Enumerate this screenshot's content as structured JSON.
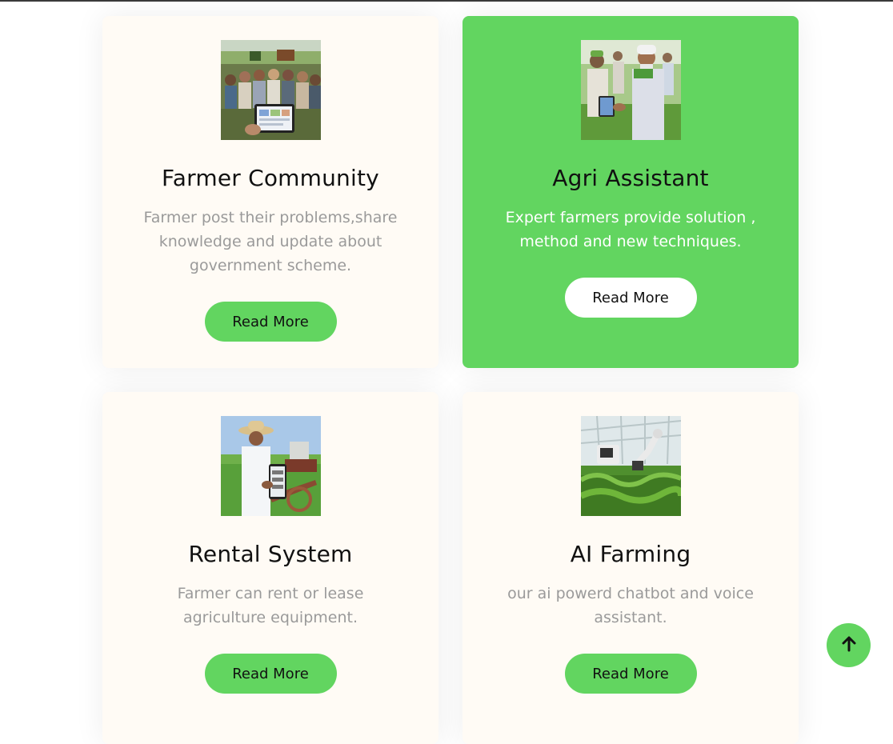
{
  "cards": [
    {
      "title": "Farmer Community",
      "description": "Farmer post their problems,share knowledge and update about government scheme.",
      "button_label": "Read More",
      "image_icon": "farmer-group-with-tablet-photo",
      "highlighted": false
    },
    {
      "title": "Agri Assistant",
      "description": "Expert farmers provide solution , method and new techniques.",
      "button_label": "Read More",
      "image_icon": "farmers-with-tablet-photo",
      "highlighted": true
    },
    {
      "title": "Rental System",
      "description": "Farmer can rent or lease agriculture equipment.",
      "button_label": "Read More",
      "image_icon": "farmer-with-phone-tractor-photo",
      "highlighted": false
    },
    {
      "title": "AI Farming",
      "description": "our ai powerd chatbot and voice assistant.",
      "button_label": "Read More",
      "image_icon": "greenhouse-robot-arm-photo",
      "highlighted": false
    }
  ],
  "scroll_top_icon": "arrow-up-icon",
  "colors": {
    "accent": "#62d560",
    "card_bg": "#fffbf5",
    "title": "#111111",
    "description": "#9a9a9a"
  }
}
